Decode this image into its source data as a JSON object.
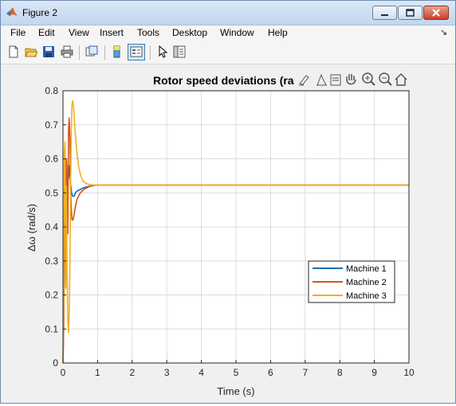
{
  "window": {
    "title": "Figure 2"
  },
  "menu": {
    "items": [
      "File",
      "Edit",
      "View",
      "Insert",
      "Tools",
      "Desktop",
      "Window",
      "Help"
    ],
    "overflow_glyph": "↘"
  },
  "toolbar": {
    "icons": [
      "new-figure-icon",
      "open-file-icon",
      "save-icon",
      "print-icon",
      "link-plot-icon",
      "insert-colorbar-icon",
      "insert-legend-icon",
      "pointer-icon",
      "property-inspector-icon"
    ]
  },
  "axes_toolbar": {
    "icons": [
      "brush-icon",
      "data-tips-icon",
      "export-icon",
      "pan-icon",
      "zoom-in-icon",
      "zoom-out-icon",
      "home-icon"
    ]
  },
  "colors": {
    "machine1": "#0072bd",
    "machine2": "#d95319",
    "machine3": "#edb120"
  },
  "chart_data": {
    "type": "line",
    "title": "Rotor speed deviations (ra",
    "xlabel": "Time (s)",
    "ylabel": "Δω (rad/s)",
    "xlim": [
      0,
      10
    ],
    "ylim": [
      0,
      0.8
    ],
    "xticks": [
      "0",
      "1",
      "2",
      "3",
      "4",
      "5",
      "6",
      "7",
      "8",
      "9",
      "10"
    ],
    "yticks": [
      "0",
      "0.1",
      "0.2",
      "0.3",
      "0.4",
      "0.5",
      "0.6",
      "0.7",
      "0.8"
    ],
    "grid": true,
    "legend_position": "center-right",
    "series": [
      {
        "name": "Machine 1",
        "color": "#0072bd",
        "x": [
          0,
          0.02,
          0.04,
          0.06,
          0.08,
          0.1,
          0.13,
          0.16,
          0.19,
          0.22,
          0.25,
          0.28,
          0.32,
          0.36,
          0.4,
          0.5,
          0.6,
          0.7,
          0.8,
          0.9,
          1.0,
          1.1,
          2,
          3,
          4,
          5,
          6,
          7,
          8,
          9,
          10
        ],
        "y": [
          0.0,
          0.12,
          0.3,
          0.46,
          0.38,
          0.52,
          0.56,
          0.54,
          0.58,
          0.53,
          0.5,
          0.49,
          0.49,
          0.5,
          0.505,
          0.51,
          0.515,
          0.518,
          0.52,
          0.522,
          0.523,
          0.523,
          0.523,
          0.523,
          0.523,
          0.523,
          0.523,
          0.523,
          0.523,
          0.523,
          0.523
        ]
      },
      {
        "name": "Machine 2",
        "color": "#d95319",
        "x": [
          0,
          0.02,
          0.04,
          0.06,
          0.08,
          0.1,
          0.12,
          0.14,
          0.16,
          0.18,
          0.2,
          0.22,
          0.24,
          0.26,
          0.28,
          0.3,
          0.33,
          0.36,
          0.4,
          0.45,
          0.5,
          0.6,
          0.7,
          0.8,
          0.9,
          1.0,
          1.1,
          2,
          3,
          4,
          5,
          6,
          7,
          8,
          9,
          10
        ],
        "y": [
          0.0,
          0.1,
          0.3,
          0.56,
          0.35,
          0.6,
          0.55,
          0.38,
          0.68,
          0.72,
          0.66,
          0.52,
          0.45,
          0.42,
          0.42,
          0.425,
          0.44,
          0.46,
          0.48,
          0.49,
          0.5,
          0.51,
          0.515,
          0.52,
          0.522,
          0.523,
          0.523,
          0.523,
          0.523,
          0.523,
          0.523,
          0.523,
          0.523,
          0.523,
          0.523,
          0.523
        ]
      },
      {
        "name": "Machine 3",
        "color": "#edb120",
        "x": [
          0,
          0.02,
          0.04,
          0.06,
          0.08,
          0.1,
          0.12,
          0.14,
          0.16,
          0.18,
          0.2,
          0.22,
          0.24,
          0.26,
          0.28,
          0.3,
          0.32,
          0.35,
          0.4,
          0.45,
          0.5,
          0.55,
          0.6,
          0.7,
          0.8,
          0.9,
          1.0,
          1.1,
          2,
          3,
          4,
          5,
          6,
          7,
          8,
          9,
          10
        ],
        "y": [
          0.0,
          0.2,
          0.62,
          0.65,
          0.22,
          0.52,
          0.25,
          0.12,
          0.09,
          0.15,
          0.3,
          0.5,
          0.68,
          0.76,
          0.77,
          0.76,
          0.73,
          0.68,
          0.62,
          0.58,
          0.555,
          0.54,
          0.532,
          0.526,
          0.524,
          0.523,
          0.523,
          0.523,
          0.523,
          0.523,
          0.523,
          0.523,
          0.523,
          0.523,
          0.523,
          0.523,
          0.523
        ]
      }
    ]
  }
}
